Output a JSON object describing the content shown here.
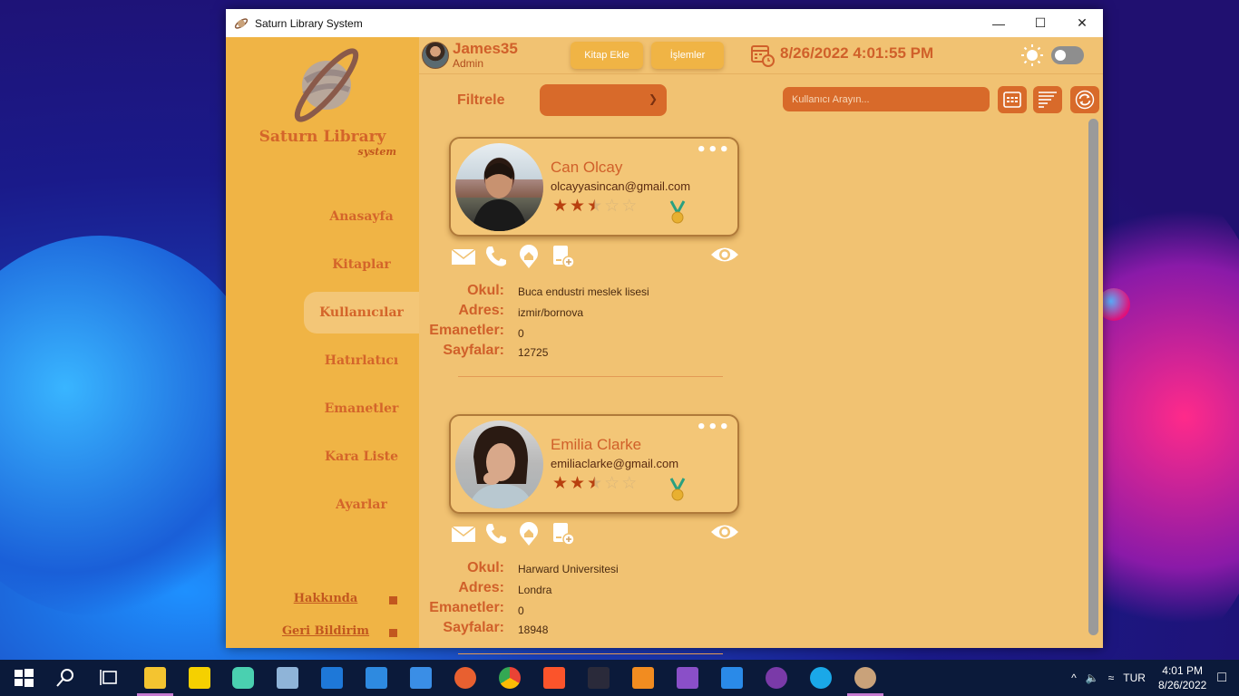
{
  "window": {
    "title": "Saturn Library System"
  },
  "sidebar": {
    "brand_title": "Saturn Library",
    "brand_subtitle": "system",
    "items": [
      {
        "label": "Anasayfa",
        "active": false
      },
      {
        "label": "Kitaplar",
        "active": false
      },
      {
        "label": "Kullanıcılar",
        "active": true
      },
      {
        "label": "Hatırlatıcı",
        "active": false
      },
      {
        "label": "Emanetler",
        "active": false
      },
      {
        "label": "Kara Liste",
        "active": false
      },
      {
        "label": "Ayarlar",
        "active": false
      }
    ],
    "footer": [
      {
        "label": "Hakkında"
      },
      {
        "label": "Geri Bildirim"
      }
    ]
  },
  "header": {
    "user_name": "James35",
    "user_role": "Admin",
    "add_book_label": "Kitap Ekle",
    "operations_label": "İşlemler",
    "datetime": "8/26/2022 4:01:55 PM"
  },
  "toolbar": {
    "filter_label": "Filtrele",
    "filter_value": "",
    "search_placeholder": "Kullanıcı Arayın..."
  },
  "labels": {
    "school": "Okul:",
    "address": "Adres:",
    "loans": "Emanetler:",
    "pages": "Sayfalar:"
  },
  "users": [
    {
      "name": "Can Olcay",
      "email": "olcayyasincan@gmail.com",
      "rating": 2.5,
      "school": "Buca endustri meslek lisesi",
      "address": "izmir/bornova",
      "loans": "0",
      "pages": "12725"
    },
    {
      "name": "Emilia Clarke",
      "email": "emiliaclarke@gmail.com",
      "rating": 2.5,
      "school": "Harward Universitesi",
      "address": "Londra",
      "loans": "0",
      "pages": "18948"
    }
  ],
  "taskbar": {
    "lang": "TUR",
    "time": "4:01 PM",
    "date": "8/26/2022"
  },
  "colors": {
    "accent": "#d0602a",
    "sidebar": "#f0b445",
    "panel": "#f1c272",
    "star_filled": "#b8400f",
    "star_empty": "#d9b57a"
  }
}
